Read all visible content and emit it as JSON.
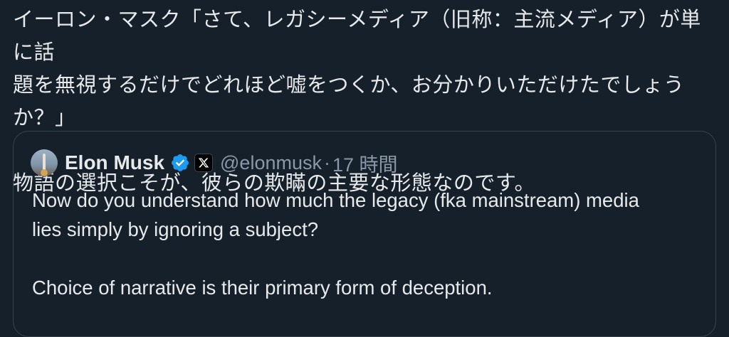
{
  "post": {
    "line1": "イーロン・マスク「さて、レガシーメディア（旧称：主流メディア）が単に話",
    "line2": "題を無視するだけでどれほど嘘をつくか、お分かりいただけたでしょうか？」",
    "line3": "物語の選択こそが、彼らの欺瞞の主要な形態なのです。"
  },
  "quote": {
    "author_name": "Elon Musk",
    "handle": "@elonmusk",
    "separator": "·",
    "time": "17 時間",
    "body_line1": "Now do you understand how much the legacy (fka mainstream) media",
    "body_line2": "lies simply by ignoring a subject?",
    "body_line3": "Choice of narrative is their primary form of deception."
  },
  "icons": {
    "verified": "verified-badge-icon",
    "x_logo": "x-logo-icon",
    "avatar": "avatar"
  },
  "colors": {
    "background": "#15202b",
    "text": "#e7e9ea",
    "muted": "#8b98a5",
    "border": "#38444d",
    "verified": "#1d9bf0"
  }
}
